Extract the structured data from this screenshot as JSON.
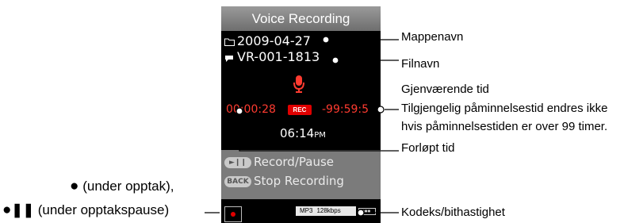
{
  "screen": {
    "title": "Voice Recording",
    "folder_name": "2009-04-27",
    "file_name": "VR-001-1813",
    "elapsed_time": "00:00:28",
    "rec_badge": "REC",
    "remaining_time": "-99:59:5",
    "clock_time": "06:14",
    "clock_ampm": "PM",
    "options": [
      {
        "button": "►❙❙",
        "label": "Record/Pause"
      },
      {
        "button": "BACK",
        "label": "Stop Recording"
      }
    ],
    "codec": "MP3",
    "bitrate": "128kbps"
  },
  "callouts": {
    "folder_name": "Mappenavn",
    "file_name": "Filnavn",
    "remaining_title": "Gjenværende tid",
    "remaining_note_1": "Tilgjengelig påminnelsestid endres ikke",
    "remaining_note_2": "hvis påminnelsestiden er over 99 timer.",
    "elapsed": "Forløpt tid",
    "codec": "Kodeks/bithastighet",
    "status_recording": "(under opptak),",
    "status_paused": "(under opptakspause)"
  },
  "icons": {
    "folder": "folder-icon",
    "file": "file-icon",
    "mic": "microphone-icon",
    "battery": "battery-icon",
    "recording_dot": "recording-dot-icon",
    "pause": "pause-icon"
  },
  "colors": {
    "screen_bg": "#000000",
    "rec_red": "#e00000",
    "time_red": "#ff3b30",
    "panel_gray": "#7b7b7b"
  }
}
